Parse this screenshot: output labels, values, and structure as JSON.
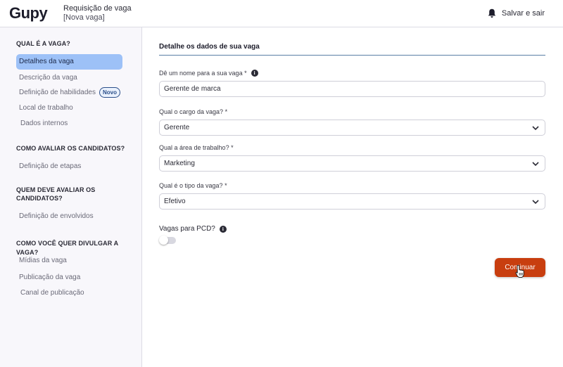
{
  "header": {
    "logo": "Gupy",
    "title": "Requisição de vaga",
    "subtitle": "[Nova vaga]",
    "save_exit": "Salvar e sair"
  },
  "sidebar": {
    "sections": [
      {
        "title": "QUAL É A VAGA?",
        "items": [
          {
            "label": "Detalhes da vaga",
            "active": true
          },
          {
            "label": "Descrição da vaga"
          },
          {
            "label": "Definição de habilidades",
            "badge": "Novo"
          },
          {
            "label": "Local de trabalho"
          },
          {
            "label": "Dados internos"
          }
        ]
      },
      {
        "title": "COMO AVALIAR OS CANDIDATOS?",
        "items": [
          {
            "label": "Definição de etapas"
          }
        ]
      },
      {
        "title": "QUEM DEVE AVALIAR OS",
        "title2": "CANDIDATOS?",
        "items": [
          {
            "label": "Definição de envolvidos"
          }
        ]
      },
      {
        "title": "COMO VOCÊ QUER DIVULGAR A VAGA?",
        "items": [
          {
            "label": "Mídias da vaga"
          },
          {
            "label": "Publicação da vaga"
          },
          {
            "label": "Canal de publicação"
          }
        ]
      }
    ]
  },
  "main": {
    "section_title": "Detalhe os dados de sua vaga",
    "fields": [
      {
        "label": "Dê um nome para a sua vaga *",
        "value": "Gerente de marca"
      },
      {
        "label": "Qual o cargo da vaga? *",
        "value": "Gerente"
      },
      {
        "label": "Qual a área de trabalho? *",
        "value": "Marketing"
      },
      {
        "label": "Qual é o tipo da vaga? *",
        "value": "Efetivo"
      }
    ],
    "info_glyph": "i",
    "pcd_label": "Vagas para PCD?",
    "pcd_enabled": false,
    "continue_label": "Continuar"
  },
  "colors": {
    "accent": "#c83e0f",
    "active_nav": "#9dc1f7"
  }
}
